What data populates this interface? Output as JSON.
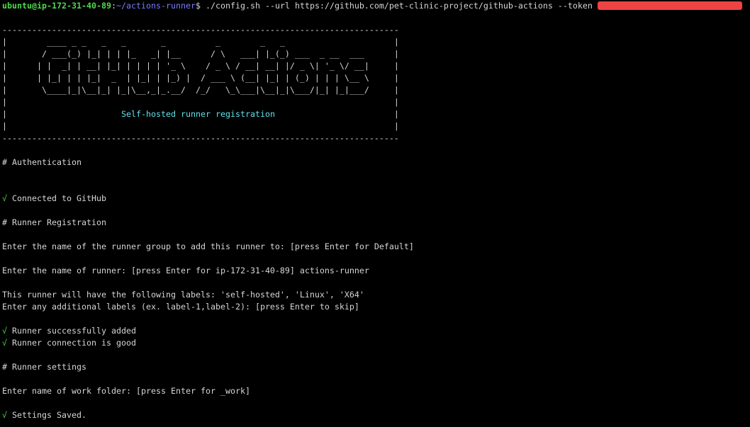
{
  "colors": {
    "background": "#000000",
    "text": "#d6d6d6",
    "user": "#4fd84f",
    "path": "#7a7cff",
    "check": "#45d645",
    "accent_cyan": "#5fe3ec",
    "redaction": "#ee4343"
  },
  "prompt": {
    "user_host": "ubuntu@ip-172-31-40-89",
    "separator": ":",
    "path": "~/actions-runner",
    "symbol": "$",
    "command": "./config.sh --url https://github.com/pet-clinic-project/github-actions --token"
  },
  "banner": {
    "border": "--------------------------------------------------------------------------------",
    "art": [
      "|        ____ _ _   _   _       _          _        _   _                      |",
      "|       / ___(_) |_| | | |_   _| |__      / \\   ___| |_(_) ___  _ __  ___      |",
      "|      | |  _| | __| |_| | | | | '_ \\    / _ \\ / __| __| |/ _ \\| '_ \\/ __|     |",
      "|      | |_| | | |_|  _  | |_| | |_) |  / ___ \\ (__| |_| | (_) | | | \\__ \\     |",
      "|       \\____|_|\\__|_| |_|\\__,_|_.__/  /_/   \\_\\___|\\__|_|\\___/|_| |_|___/     |"
    ],
    "frame_empty": "|                                                                              |",
    "subtitle_left": "|                       ",
    "subtitle": "Self-hosted runner registration",
    "subtitle_right": "                        |"
  },
  "output": {
    "auth_heading": "# Authentication",
    "connected": {
      "mark": "√",
      "text": "Connected to GitHub"
    },
    "registration_heading": "# Runner Registration",
    "group_prompt": "Enter the name of the runner group to add this runner to: [press Enter for Default]",
    "name_prompt": "Enter the name of runner: [press Enter for ip-172-31-40-89] actions-runner",
    "labels_info": "This runner will have the following labels: 'self-hosted', 'Linux', 'X64'",
    "labels_prompt": "Enter any additional labels (ex. label-1,label-2): [press Enter to skip]",
    "added": {
      "mark": "√",
      "text": "Runner successfully added"
    },
    "connection": {
      "mark": "√",
      "text": "Runner connection is good"
    },
    "settings_heading": "# Runner settings",
    "work_folder_prompt": "Enter name of work folder: [press Enter for _work]",
    "saved": {
      "mark": "√",
      "text": "Settings Saved."
    }
  }
}
